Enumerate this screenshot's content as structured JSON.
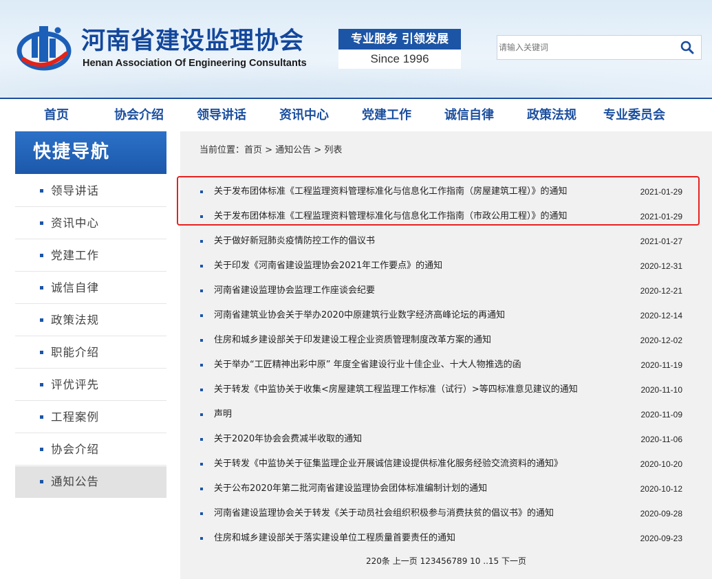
{
  "header": {
    "title": "河南省建设监理协会",
    "subtitle": "Henan Association Of Engineering Consultants",
    "slogan_top": "专业服务 引领发展",
    "slogan_bottom": "Since  1996",
    "search_placeholder": "请输入关键词"
  },
  "nav": [
    "首页",
    "协会介绍",
    "领导讲话",
    "资讯中心",
    "党建工作",
    "诚信自律",
    "政策法规",
    "专业委员会"
  ],
  "sidebar": {
    "title": "快捷导航",
    "items": [
      "领导讲话",
      "资讯中心",
      "党建工作",
      "诚信自律",
      "政策法规",
      "职能介绍",
      "评优评先",
      "工程案例",
      "协会介绍",
      "通知公告"
    ],
    "active": "通知公告"
  },
  "breadcrumb": {
    "prefix": "当前位置：",
    "home": "首页",
    "sep1": " > ",
    "section": "通知公告",
    "sep2": " > ",
    "current": "列表"
  },
  "list": [
    {
      "title": "关于发布团体标准《工程监理资料管理标准化与信息化工作指南（房屋建筑工程）》的通知",
      "date": "2021-01-29"
    },
    {
      "title": "关于发布团体标准《工程监理资料管理标准化与信息化工作指南（市政公用工程）》的通知",
      "date": "2021-01-29"
    },
    {
      "title": "关于做好新冠肺炎疫情防控工作的倡议书",
      "date": "2021-01-27"
    },
    {
      "title": "关于印发《河南省建设监理协会2021年工作要点》的通知",
      "date": "2020-12-31"
    },
    {
      "title": "河南省建设监理协会监理工作座谈会纪要",
      "date": "2020-12-21"
    },
    {
      "title": "河南省建筑业协会关于举办2020中原建筑行业数字经济高峰论坛的再通知",
      "date": "2020-12-14"
    },
    {
      "title": "住房和城乡建设部关于印发建设工程企业资质管理制度改革方案的通知",
      "date": "2020-12-02"
    },
    {
      "title": "关于举办“工匠精神出彩中原” 年度全省建设行业十佳企业、十大人物推选的函",
      "date": "2020-11-19"
    },
    {
      "title": "关于转发《中监协关于收集<房屋建筑工程监理工作标准（试行）>等四标准意见建议的通知",
      "date": "2020-11-10"
    },
    {
      "title": "声明",
      "date": "2020-11-09"
    },
    {
      "title": "关于2020年协会会费减半收取的通知",
      "date": "2020-11-06"
    },
    {
      "title": "关于转发《中监协关于征集监理企业开展诚信建设提供标准化服务经验交流资料的通知》",
      "date": "2020-10-20"
    },
    {
      "title": "关于公布2020年第二批河南省建设监理协会团体标准编制计划的通知",
      "date": "2020-10-12"
    },
    {
      "title": "河南省建设监理协会关于转发《关于动员社会组织积极参与消费扶贫的倡议书》的通知",
      "date": "2020-09-28"
    },
    {
      "title": "住房和城乡建设部关于落实建设单位工程质量首要责任的通知",
      "date": "2020-09-23"
    }
  ],
  "pager": {
    "total": "220条",
    "prev": "上一页",
    "pages": [
      "1",
      "2",
      "3",
      "4",
      "5",
      "6",
      "7",
      "8",
      "9",
      "10"
    ],
    "ellipsis": "..15",
    "next": "下一页"
  },
  "colors": {
    "brand_blue": "#13479b",
    "nav_blue": "#1b4e9e",
    "highlight_red": "#e8201f",
    "sidebar_active": "#e2e2e2"
  },
  "icons": {
    "logo": "association-logo",
    "search": "search-icon"
  }
}
